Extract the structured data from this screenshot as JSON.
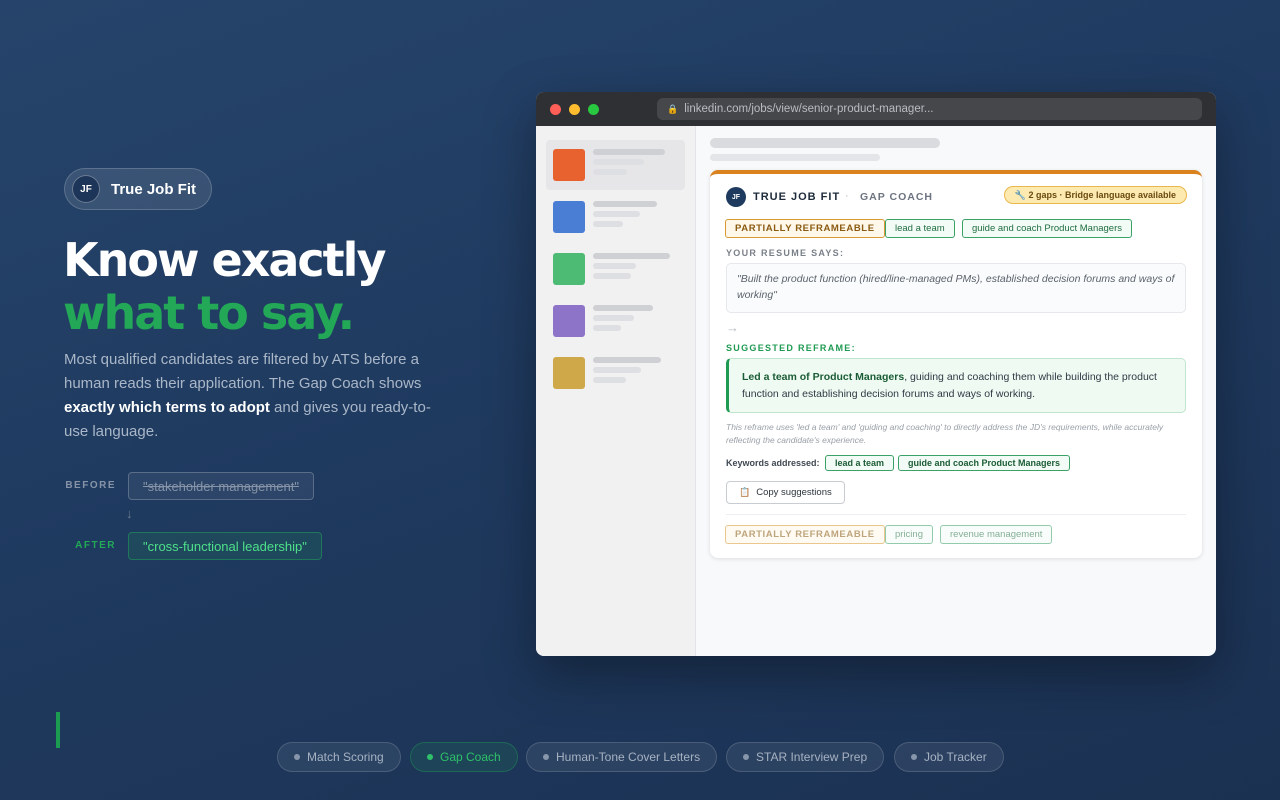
{
  "brand": {
    "badge": "JF",
    "name": "True Job Fit"
  },
  "hero": {
    "line1": "Know exactly",
    "line2": "what to say.",
    "lead_part1": "Most qualified candidates are filtered by ATS before a human reads their application. The Gap Coach shows ",
    "lead_bold": "exactly which terms to adopt",
    "lead_part2": " and gives you ready-to-use language."
  },
  "before_after": {
    "before_label": "BEFORE",
    "before_value": "\"stakeholder management\"",
    "after_label": "AFTER",
    "after_value": "\"cross-functional leadership\""
  },
  "browser": {
    "url": "linkedin.com/jobs/view/senior-product-manager...",
    "job_logo_colors": [
      "#e8622f",
      "#4a7ed4",
      "#4dbb74",
      "#8e74c8",
      "#cfa84a"
    ]
  },
  "panel": {
    "badge": "JF",
    "title": "TRUE JOB FIT",
    "separator": "·",
    "subtitle": "GAP COACH",
    "gaps_badge": "🔧 2 gaps · Bridge language available",
    "gap1": {
      "status": "PARTIALLY REFRAMEABLE",
      "keywords": [
        "lead a team",
        "guide and coach Product Managers"
      ],
      "resume_label": "YOUR RESUME SAYS:",
      "resume_text": "\"Built the product function (hired/line-managed PMs), established decision forums and ways of working\"",
      "arrow": "→",
      "reframe_label": "SUGGESTED REFRAME:",
      "reframe_bold": "Led a team of Product Managers",
      "reframe_rest": ", guiding and coaching them while building the product function and establishing decision forums and ways of working.",
      "note": "This reframe uses 'led a team' and 'guiding and coaching' to directly address the JD's requirements, while accurately reflecting the candidate's experience.",
      "keywords_label": "Keywords addressed:",
      "addressed": [
        "lead a team",
        "guide and coach Product Managers"
      ],
      "copy_label": "Copy suggestions"
    },
    "gap2": {
      "status": "PARTIALLY REFRAMEABLE",
      "keywords": [
        "pricing",
        "revenue management"
      ]
    }
  },
  "features": [
    {
      "label": "Match Scoring",
      "active": false
    },
    {
      "label": "Gap Coach",
      "active": true
    },
    {
      "label": "Human-Tone Cover Letters",
      "active": false
    },
    {
      "label": "STAR Interview Prep",
      "active": false
    },
    {
      "label": "Job Tracker",
      "active": false
    }
  ],
  "colors": {
    "accent_green": "#22a857",
    "panel_orange": "#d9821e",
    "navy": "#1f3a5f"
  }
}
